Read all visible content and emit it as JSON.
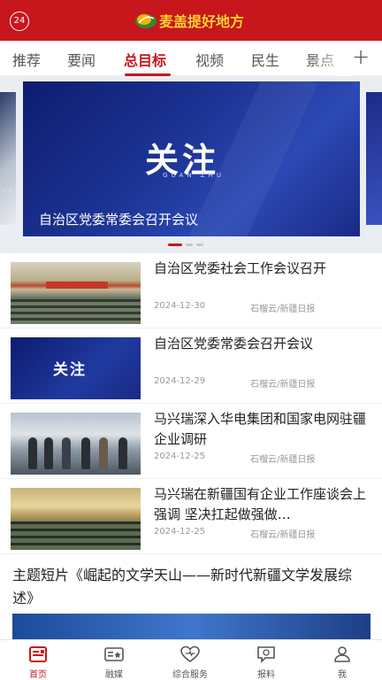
{
  "header": {
    "badge": "24",
    "logo_text": "麦盖提好地方",
    "brand_color": "#c8161d"
  },
  "tabs": [
    {
      "label": "推荐"
    },
    {
      "label": "要闻"
    },
    {
      "label": "总目标",
      "active": true
    },
    {
      "label": "视频"
    },
    {
      "label": "民生"
    },
    {
      "label": "景点"
    }
  ],
  "tab_more_icon": "+",
  "carousel": {
    "slide_logo": "关注",
    "slide_logo_sub": "GUAN ZHU",
    "caption": "自治区党委常委会召开会议",
    "side_dots": "·  ·  ·",
    "current_index": 1,
    "total": 3
  },
  "news": [
    {
      "title": "自治区党委社会工作会议召开",
      "date": "2024-12-30",
      "source": "石榴云/新疆日报",
      "thumb": "meeting-photo"
    },
    {
      "title": "自治区党委常委会召开会议",
      "date": "2024-12-29",
      "source": "石榴云/新疆日报",
      "thumb": "guanzhu-graphic",
      "thumb_text": "关注"
    },
    {
      "title": "马兴瑞深入华电集团和国家电网驻疆企业调研",
      "date": "2024-12-25",
      "source": "石榴云/新疆日报",
      "thumb": "people-photo"
    },
    {
      "title": "马兴瑞在新疆国有企业工作座谈会上强调 坚决扛起做强做…",
      "date": "2024-12-25",
      "source": "石榴云/新疆日报",
      "thumb": "hall-photo"
    }
  ],
  "topic": {
    "title": "主题短片《崛起的文学天山——新时代新疆文学发展综述》"
  },
  "bottom_nav": [
    {
      "label": "首页",
      "icon": "home-icon",
      "active": true
    },
    {
      "label": "融媒",
      "icon": "media-icon"
    },
    {
      "label": "综合服务",
      "icon": "service-icon"
    },
    {
      "label": "报料",
      "icon": "report-icon"
    },
    {
      "label": "我",
      "icon": "profile-icon"
    }
  ]
}
